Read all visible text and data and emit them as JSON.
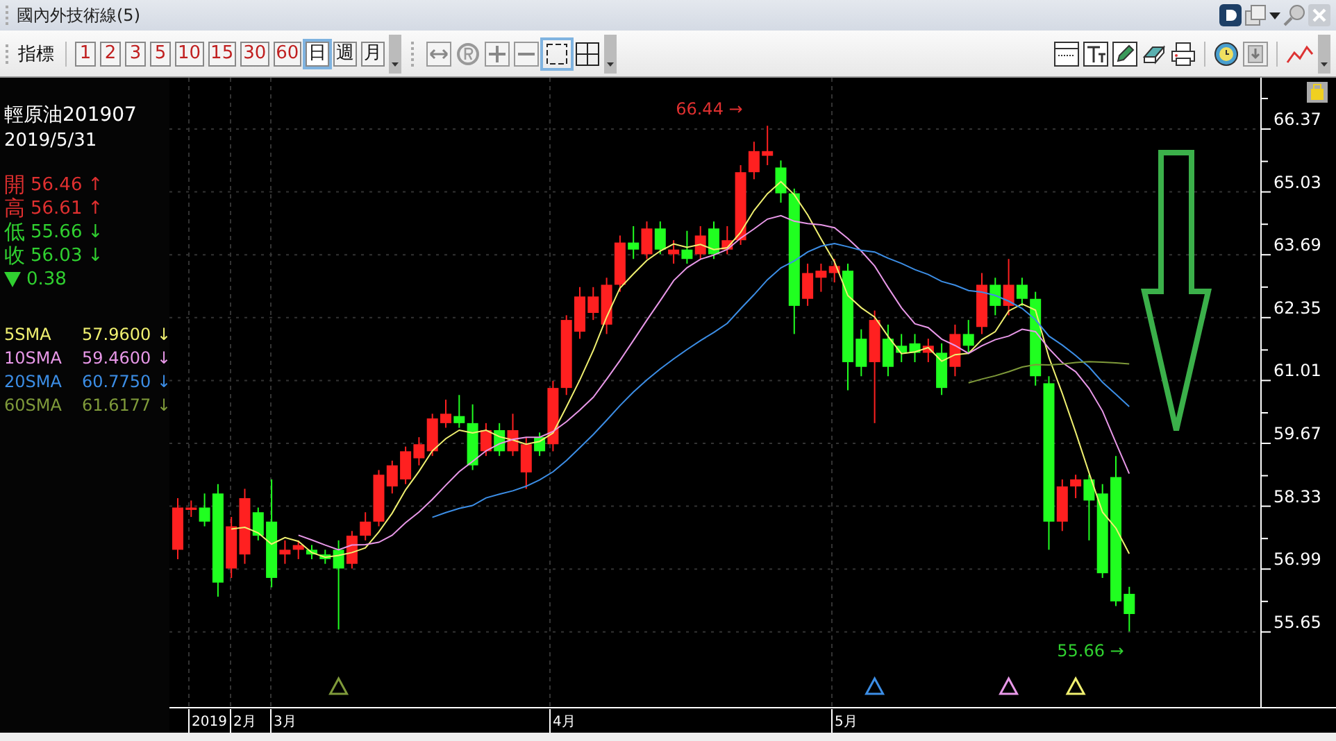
{
  "window": {
    "title": "國內外技術線(5)"
  },
  "toolbar": {
    "label": "指標",
    "buttons": [
      {
        "text": "1",
        "kind": "minute",
        "selected": false
      },
      {
        "text": "2",
        "kind": "minute",
        "selected": false
      },
      {
        "text": "3",
        "kind": "minute",
        "selected": false
      },
      {
        "text": "5",
        "kind": "minute",
        "selected": false
      },
      {
        "text": "10",
        "kind": "minute",
        "selected": false
      },
      {
        "text": "15",
        "kind": "minute",
        "selected": false
      },
      {
        "text": "30",
        "kind": "minute",
        "selected": false
      },
      {
        "text": "60",
        "kind": "minute",
        "selected": false
      },
      {
        "text": "日",
        "kind": "period",
        "selected": true
      },
      {
        "text": "週",
        "kind": "period",
        "selected": false
      },
      {
        "text": "月",
        "kind": "period",
        "selected": false
      }
    ]
  },
  "info": {
    "symbol": "輕原油201907",
    "date": "2019/5/31",
    "quotes": [
      {
        "label": "開",
        "value": "56.46",
        "arrow": "↑",
        "color": "#e03030"
      },
      {
        "label": "高",
        "value": "56.61",
        "arrow": "↑",
        "color": "#e03030"
      },
      {
        "label": "低",
        "value": "55.66",
        "arrow": "↓",
        "color": "#30d030"
      },
      {
        "label": "收",
        "value": "56.03",
        "arrow": "↓",
        "color": "#30d030"
      }
    ],
    "change": {
      "value": "0.38",
      "falling": true
    },
    "averages": [
      {
        "name": "5SMA",
        "value": "57.9600",
        "arrow": "↓",
        "color": "#f0f070"
      },
      {
        "name": "10SMA",
        "value": "59.4600",
        "arrow": "↓",
        "color": "#e898e8"
      },
      {
        "name": "20SMA",
        "value": "60.7750",
        "arrow": "↓",
        "color": "#3c8ee6"
      },
      {
        "name": "60SMA",
        "value": "61.6177",
        "arrow": "↓",
        "color": "#7f9a3a"
      }
    ]
  },
  "chart": {
    "price_axis": [
      "66.37",
      "65.03",
      "63.69",
      "62.35",
      "61.01",
      "59.67",
      "58.33",
      "56.99",
      "55.65"
    ],
    "time_axis": [
      "2019",
      "2月",
      "3月",
      "4月",
      "5月"
    ],
    "high_label": "66.44 →",
    "low_label": "55.66 →",
    "markers": [
      {
        "color": "#7f9a3a"
      },
      {
        "color": "#3c8ee6"
      },
      {
        "color": "#e898e8"
      },
      {
        "color": "#f0f070"
      }
    ]
  }
}
